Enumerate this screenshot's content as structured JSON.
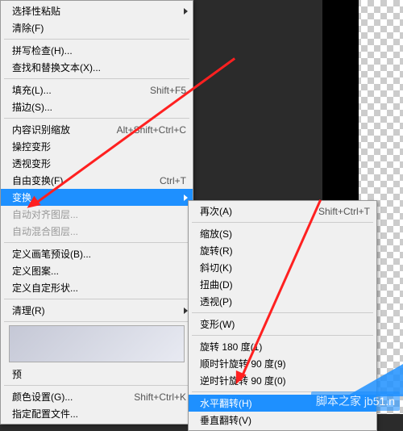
{
  "main_menu": {
    "paste_special": "选择性粘贴",
    "purge": "清除(F)",
    "spell_check": "拼写检查(H)...",
    "find_replace": "查找和替换文本(X)...",
    "fill": "填充(L)...",
    "fill_shortcut": "Shift+F5",
    "stroke": "描边(S)...",
    "content_aware": "内容识别缩放",
    "content_aware_shortcut": "Alt+Shift+Ctrl+C",
    "puppet_warp": "操控变形",
    "perspective_warp": "透视变形",
    "free_transform": "自由变换(F)",
    "free_transform_shortcut": "Ctrl+T",
    "transform": "变换",
    "auto_align": "自动对齐图层...",
    "auto_blend": "自动混合图层...",
    "define_brush": "定义画笔预设(B)...",
    "define_pattern": "定义图案...",
    "define_shape": "定义自定形状...",
    "purge_menu": "清理(R)",
    "preset_mgr_prefix": "预",
    "color_settings": "颜色设置(G)...",
    "color_settings_shortcut": "Shift+Ctrl+K",
    "assign_profile": "指定配置文件..."
  },
  "submenu": {
    "again": "再次(A)",
    "again_shortcut": "Shift+Ctrl+T",
    "scale": "缩放(S)",
    "rotate": "旋转(R)",
    "skew": "斜切(K)",
    "distort": "扭曲(D)",
    "perspective": "透视(P)",
    "warp": "变形(W)",
    "rotate_180": "旋转 180 度(1)",
    "rotate_cw": "顺时针旋转 90 度(9)",
    "rotate_ccw": "逆时针旋转 90 度(0)",
    "flip_h": "水平翻转(H)",
    "flip_v": "垂直翻转(V)"
  },
  "watermark": "脚本之家 jb51.n"
}
